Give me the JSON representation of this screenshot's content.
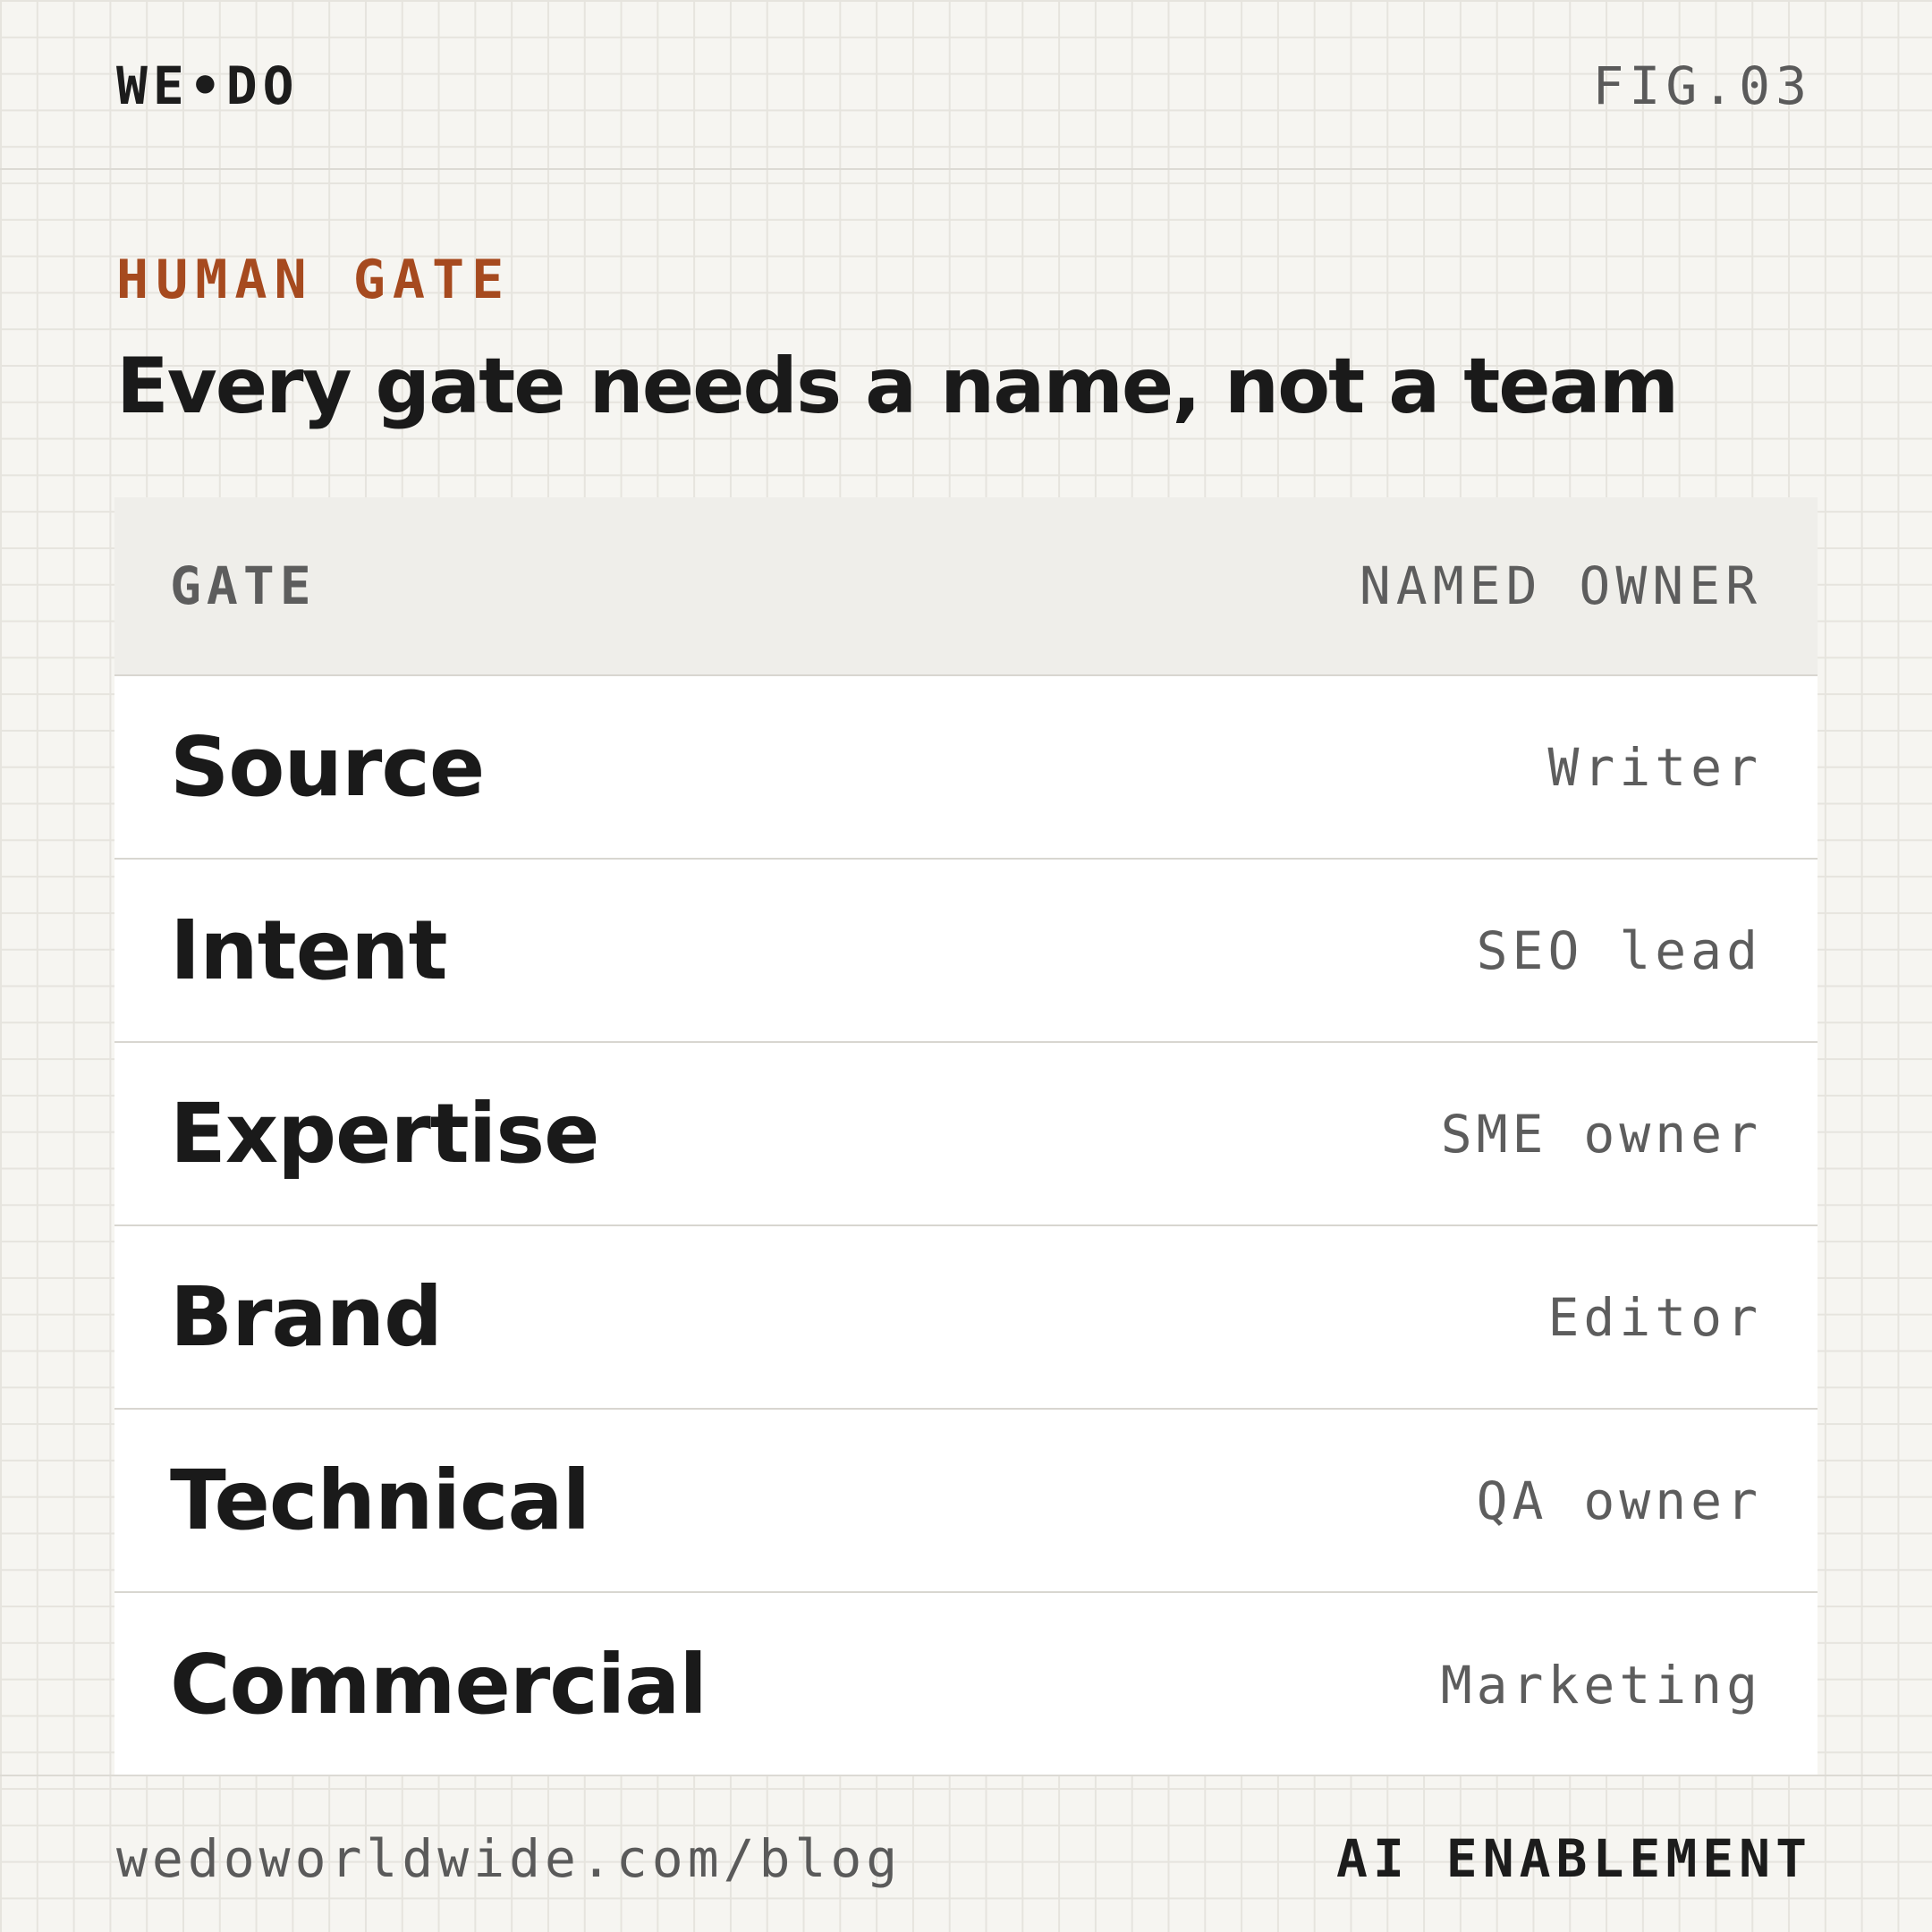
{
  "header": {
    "logo": "WE•DO",
    "figure_label": "FIG.03"
  },
  "section": {
    "eyebrow": "HUMAN GATE",
    "title": "Every gate needs a name, not a team"
  },
  "table": {
    "columns": [
      "GATE",
      "NAMED OWNER"
    ],
    "rows": [
      {
        "gate": "Source",
        "owner": "Writer"
      },
      {
        "gate": "Intent",
        "owner": "SEO lead"
      },
      {
        "gate": "Expertise",
        "owner": "SME owner"
      },
      {
        "gate": "Brand",
        "owner": "Editor"
      },
      {
        "gate": "Technical",
        "owner": "QA owner"
      },
      {
        "gate": "Commercial",
        "owner": "Marketing"
      }
    ]
  },
  "footer": {
    "url": "wedoworldwide.com/blog",
    "category": "AI ENABLEMENT"
  },
  "colors": {
    "background": "#f6f5f1",
    "accent": "#a64a1f",
    "text": "#1a1a1a",
    "muted": "#5d5d5d"
  }
}
